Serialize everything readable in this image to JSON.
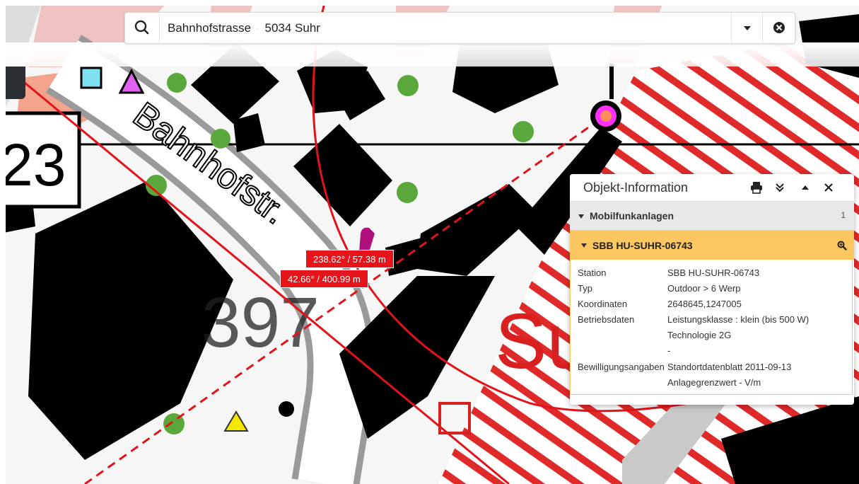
{
  "search": {
    "value_street": "Bahnhofstrasse",
    "value_place": "5034 Suhr"
  },
  "map": {
    "labels": {
      "road_number": "23",
      "street_name": "Bahnhofstr.",
      "house_number": "397",
      "place_fragment": "Su"
    },
    "measurements": [
      {
        "text": "238.62° / 57.38 m"
      },
      {
        "text": "42.66° / 400.99 m"
      }
    ],
    "colors": {
      "measure_red": "#e8141b",
      "zone_red": "#e02a2a",
      "building": "#000000",
      "tree": "#5aa83c",
      "station_magenta": "#ff30ff",
      "station_orange": "#ff8c5a"
    }
  },
  "panel": {
    "title": "Objekt-Information",
    "icons": [
      "print-icon",
      "expand-all-icon",
      "collapse-up-icon",
      "close-icon"
    ],
    "category": {
      "label": "Mobilfunkanlagen",
      "count": "1"
    },
    "object": {
      "label": "SBB HU-SUHR-06743",
      "attributes": [
        {
          "key": "Station",
          "values": [
            "SBB HU-SUHR-06743"
          ]
        },
        {
          "key": "Typ",
          "values": [
            "Outdoor > 6 Werp"
          ]
        },
        {
          "key": "Koordinaten",
          "values": [
            "2648645,1247005"
          ]
        },
        {
          "key": "Betriebsdaten",
          "values": [
            "Leistungsklasse : klein (bis 500 W)",
            "Technologie 2G",
            "-"
          ]
        },
        {
          "key": "Bewilligungsangaben",
          "values": [
            "Standortdatenblatt 2011-09-13",
            "Anlagegrenzwert - V/m"
          ]
        }
      ]
    },
    "colors": {
      "object_header": "#fcc761",
      "category_bg": "#e8e8e8"
    }
  }
}
